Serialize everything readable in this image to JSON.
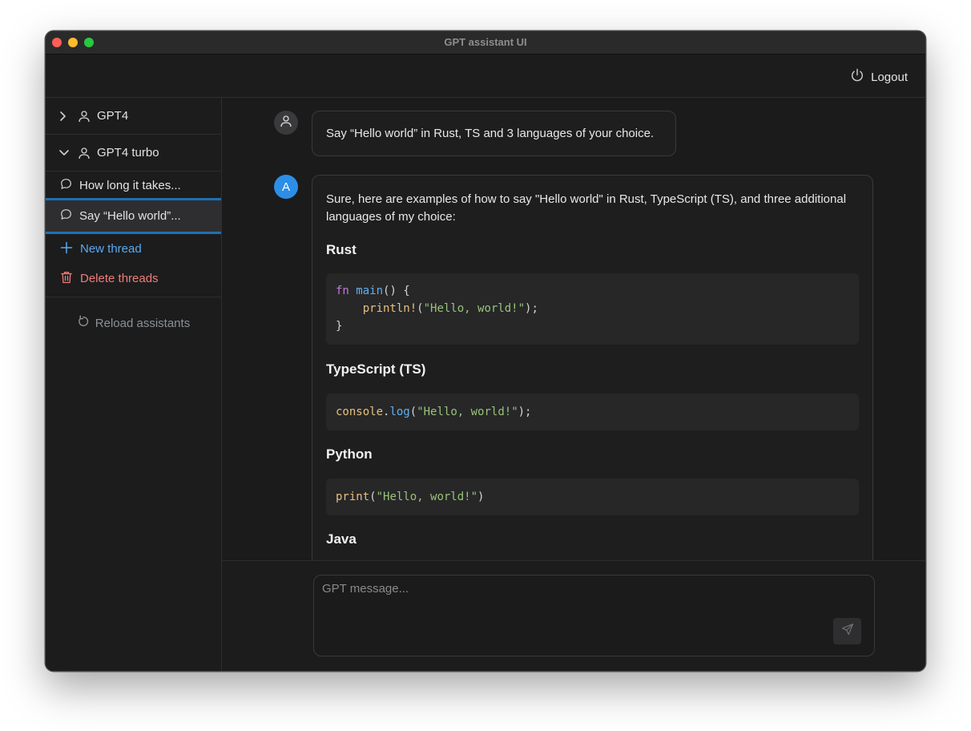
{
  "window": {
    "title": "GPT assistant UI"
  },
  "topbar": {
    "logout_label": "Logout"
  },
  "sidebar": {
    "assistants": [
      {
        "label": "GPT4",
        "expanded": false
      },
      {
        "label": "GPT4 turbo",
        "expanded": true
      }
    ],
    "threads": [
      {
        "label": "How long it takes..."
      },
      {
        "label": "Say “Hello world”..."
      }
    ],
    "new_thread_label": "New thread",
    "delete_threads_label": "Delete threads",
    "reload_label": "Reload assistants"
  },
  "chat": {
    "user_message": "Say “Hello world” in Rust, TS and 3 languages of your choice.",
    "assistant_avatar_letter": "A",
    "assistant_intro": "Sure, here are examples of how to say \"Hello world\" in Rust, TypeScript (TS), and three additional languages of my choice:",
    "sections": [
      {
        "heading": "Rust"
      },
      {
        "heading": "TypeScript (TS)"
      },
      {
        "heading": "Python"
      },
      {
        "heading": "Java"
      }
    ],
    "code": {
      "rust_kw": "fn",
      "rust_fn": "main",
      "rust_open": "() {",
      "rust_indent": "    ",
      "rust_macro": "println!",
      "rust_call_open": "(",
      "rust_string": "\"Hello, world!\"",
      "rust_call_close": ");",
      "rust_close": "}",
      "ts_obj": "console",
      "ts_dot": ".",
      "ts_fn": "log",
      "ts_open": "(",
      "ts_string": "\"Hello, world!\"",
      "ts_close": ");",
      "py_fn": "print",
      "py_open": "(",
      "py_string": "\"Hello, world!\"",
      "py_close": ")"
    }
  },
  "composer": {
    "placeholder": "GPT message..."
  },
  "colors": {
    "accent_blue": "#5aa9ee",
    "danger_red": "#f07c78",
    "avatar_blue": "#2d8ee6"
  },
  "icons": {
    "logout": "power-icon",
    "collapsed": "chevron-right-icon",
    "expanded": "chevron-down-icon",
    "assistant": "person-icon",
    "thread": "chat-bubble-icon",
    "new": "plus-icon",
    "delete": "trash-icon",
    "reload": "reload-icon",
    "send": "send-icon"
  }
}
